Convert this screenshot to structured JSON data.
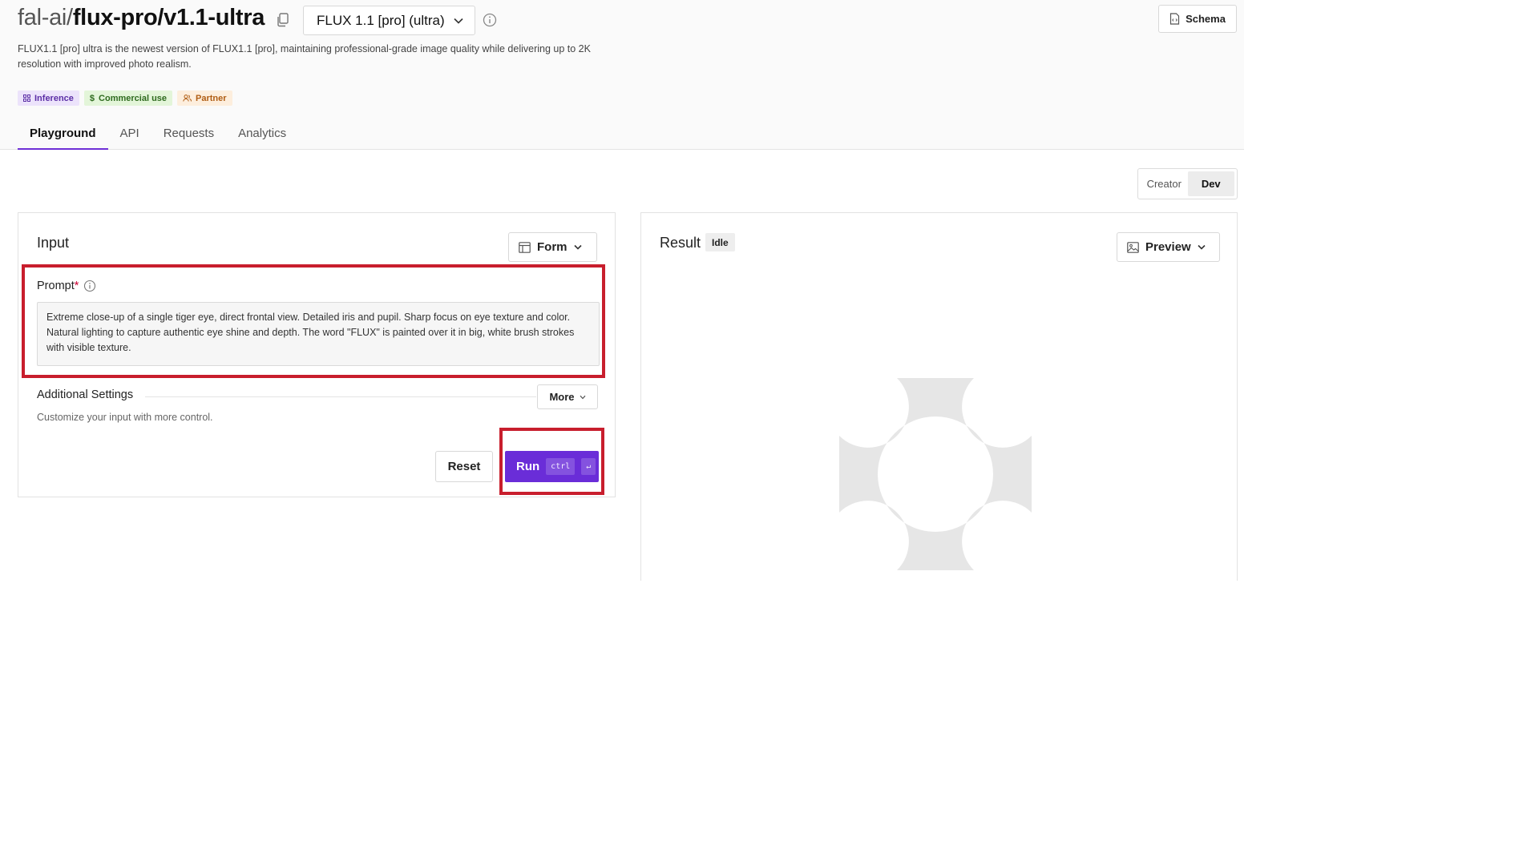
{
  "header": {
    "org": "fal-ai/",
    "model": "flux-pro/v1.1-ultra",
    "version_selected": "FLUX 1.1 [pro] (ultra)",
    "schema_label": "Schema",
    "description": "FLUX1.1 [pro] ultra is the newest version of FLUX1.1 [pro], maintaining professional-grade image quality while delivering up to 2K resolution with improved photo realism.",
    "badges": [
      {
        "label": "Inference",
        "icon": "grid-icon"
      },
      {
        "label": "Commercial use",
        "icon": "dollar-icon"
      },
      {
        "label": "Partner",
        "icon": "users-icon"
      }
    ]
  },
  "tabs": [
    {
      "label": "Playground",
      "active": true
    },
    {
      "label": "API",
      "active": false
    },
    {
      "label": "Requests",
      "active": false
    },
    {
      "label": "Analytics",
      "active": false
    }
  ],
  "mode": {
    "options": [
      "Creator",
      "Dev"
    ],
    "selected": "Dev"
  },
  "input_panel": {
    "title": "Input",
    "view_label": "Form",
    "prompt_label": "Prompt",
    "prompt_required_mark": "*",
    "prompt_value": "Extreme close-up of a single tiger eye, direct frontal view. Detailed iris and pupil. Sharp focus on eye texture and color. Natural lighting to capture authentic eye shine and depth. The word \"FLUX\" is painted over it in big, white brush strokes with visible texture.",
    "additional_settings_label": "Additional Settings",
    "more_label": "More",
    "additional_settings_sub": "Customize your input with more control.",
    "reset_label": "Reset",
    "run_label": "Run",
    "run_shortcut_key1": "ctrl",
    "run_shortcut_key2": "↵"
  },
  "result_panel": {
    "title": "Result",
    "status": "Idle",
    "view_label": "Preview"
  },
  "colors": {
    "accent": "#6a2dd8",
    "highlight_box": "#c81e2d",
    "placeholder": "#e6e6e6"
  }
}
